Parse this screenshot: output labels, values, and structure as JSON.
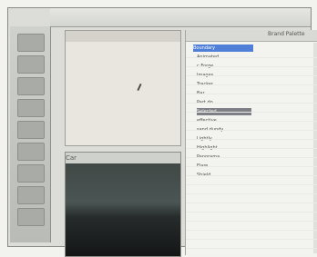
{
  "window_title": "",
  "panel": {
    "title": "Brand Palette",
    "subtitle": "",
    "tree": [
      {
        "label": "Boundary",
        "state": "top"
      },
      {
        "label": "Animated",
        "state": "normal"
      },
      {
        "label": "c Forge",
        "state": "normal"
      },
      {
        "label": "Images",
        "state": "normal"
      },
      {
        "label": "Tracker",
        "state": "normal"
      },
      {
        "label": "Bar",
        "state": "normal"
      },
      {
        "label": "Part do",
        "state": "normal"
      },
      {
        "label": "Selected",
        "state": "selected"
      },
      {
        "label": "effective",
        "state": "normal"
      },
      {
        "label": "sand dundy",
        "state": "normal"
      },
      {
        "label": "Lightly",
        "state": "normal"
      },
      {
        "label": "Highlight",
        "state": "normal"
      },
      {
        "label": "Panorama",
        "state": "normal"
      },
      {
        "label": "Flare",
        "state": "normal"
      },
      {
        "label": "Shield",
        "state": "normal"
      }
    ]
  },
  "viewports": {
    "top_title": "",
    "bottom_title": "Car"
  },
  "colors": {
    "accent": "#4f7fd6",
    "selected": "#7d7e86"
  }
}
